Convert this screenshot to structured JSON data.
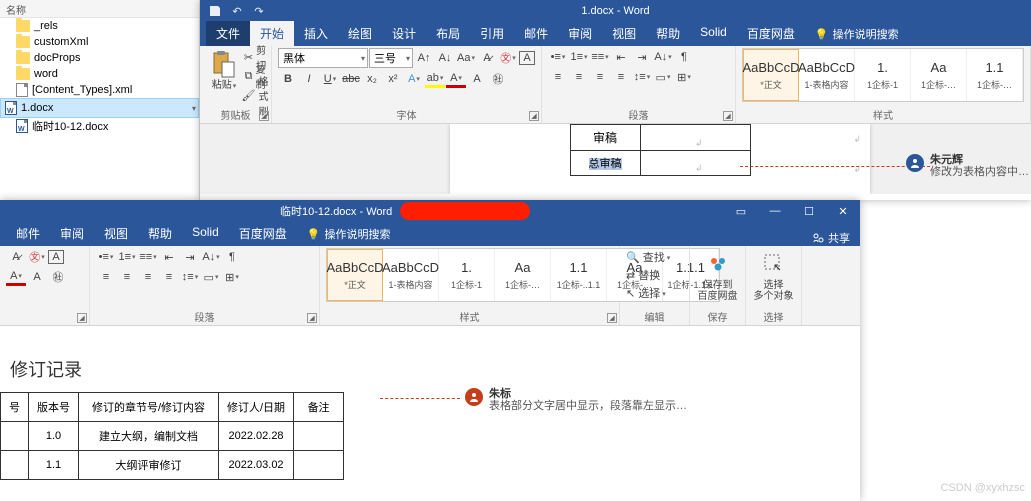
{
  "explorer": {
    "header": "名称",
    "items": [
      {
        "name": "_rels",
        "type": "folder"
      },
      {
        "name": "customXml",
        "type": "folder"
      },
      {
        "name": "docProps",
        "type": "folder"
      },
      {
        "name": "word",
        "type": "folder"
      },
      {
        "name": "[Content_Types].xml",
        "type": "file"
      },
      {
        "name": "1.docx",
        "type": "worddoc",
        "selected": true
      },
      {
        "name": "临时10-12.docx",
        "type": "worddoc"
      }
    ]
  },
  "word1": {
    "title": "1.docx - Word",
    "file_tab": "文件",
    "tabs": [
      "开始",
      "插入",
      "绘图",
      "设计",
      "布局",
      "引用",
      "邮件",
      "审阅",
      "视图",
      "帮助",
      "Solid",
      "百度网盘"
    ],
    "active": 0,
    "tell": "操作说明搜索",
    "clipboard": {
      "paste": "粘贴",
      "cut": "剪切",
      "copy": "复制",
      "fmt": "格式刷",
      "label": "剪贴板"
    },
    "font": {
      "name": "黑体",
      "size": "三号",
      "label": "字体"
    },
    "para": {
      "label": "段落"
    },
    "styles": {
      "label": "样式",
      "items": [
        {
          "preview": "AaBbCcD",
          "name": "*正文"
        },
        {
          "preview": "AaBbCcD",
          "name": "1-表格内容"
        },
        {
          "preview": "1.",
          "name": "1企标-1"
        },
        {
          "preview": "Aa",
          "name": "1企标-…"
        },
        {
          "preview": "1.1",
          "name": "1企标-…"
        }
      ]
    },
    "table": {
      "r1": "审稿",
      "r2": "总审稿"
    },
    "comment": {
      "author": "朱元辉",
      "text": "修改为表格内容中…"
    }
  },
  "word2": {
    "title": "临时10-12.docx - Word",
    "share": "共享",
    "tabs_visible": [
      "邮件",
      "审阅",
      "视图",
      "帮助",
      "Solid",
      "百度网盘"
    ],
    "tell": "操作说明搜索",
    "para": {
      "label": "段落"
    },
    "styles": {
      "label": "样式",
      "items": [
        {
          "preview": "AaBbCcD",
          "name": "*正文"
        },
        {
          "preview": "AaBbCcD",
          "name": "1-表格内容"
        },
        {
          "preview": "1.",
          "name": "1企标-1"
        },
        {
          "preview": "Aa",
          "name": "1企标-…"
        },
        {
          "preview": "1.1",
          "name": "1企标-..1.1"
        },
        {
          "preview": "Aa",
          "name": "1企标-…"
        },
        {
          "preview": "1.1.1",
          "name": "1企标-1.1.1"
        }
      ]
    },
    "edit": {
      "find": "查找",
      "replace": "替换",
      "select": "选择",
      "label": "编辑"
    },
    "baidu": {
      "btn": "保存到\n百度网盘",
      "label": "保存"
    },
    "selobj": {
      "btn": "选择\n多个对象",
      "label": "选择"
    },
    "doc": {
      "heading": "修订记录",
      "headers": [
        "号",
        "版本号",
        "修订的章节号/修订内容",
        "修订人/日期",
        "备注"
      ],
      "rows": [
        [
          "",
          "1.0",
          "建立大纲，编制文档",
          "2022.02.28",
          ""
        ],
        [
          "",
          "1.1",
          "大纲评审修订",
          "2022.03.02",
          ""
        ]
      ]
    },
    "comment": {
      "author": "朱标",
      "text": "表格部分文字居中显示，段落靠左显示…"
    }
  },
  "watermark": "CSDN @xyxhzsc"
}
